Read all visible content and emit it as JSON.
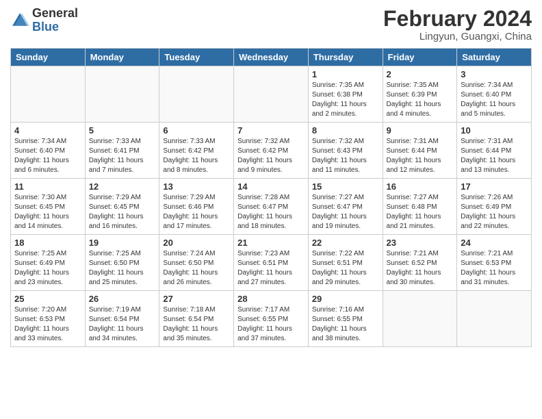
{
  "header": {
    "logo_general": "General",
    "logo_blue": "Blue",
    "month_title": "February 2024",
    "location": "Lingyun, Guangxi, China"
  },
  "days_of_week": [
    "Sunday",
    "Monday",
    "Tuesday",
    "Wednesday",
    "Thursday",
    "Friday",
    "Saturday"
  ],
  "weeks": [
    [
      {
        "num": "",
        "info": ""
      },
      {
        "num": "",
        "info": ""
      },
      {
        "num": "",
        "info": ""
      },
      {
        "num": "",
        "info": ""
      },
      {
        "num": "1",
        "info": "Sunrise: 7:35 AM\nSunset: 6:38 PM\nDaylight: 11 hours and 2 minutes."
      },
      {
        "num": "2",
        "info": "Sunrise: 7:35 AM\nSunset: 6:39 PM\nDaylight: 11 hours and 4 minutes."
      },
      {
        "num": "3",
        "info": "Sunrise: 7:34 AM\nSunset: 6:40 PM\nDaylight: 11 hours and 5 minutes."
      }
    ],
    [
      {
        "num": "4",
        "info": "Sunrise: 7:34 AM\nSunset: 6:40 PM\nDaylight: 11 hours and 6 minutes."
      },
      {
        "num": "5",
        "info": "Sunrise: 7:33 AM\nSunset: 6:41 PM\nDaylight: 11 hours and 7 minutes."
      },
      {
        "num": "6",
        "info": "Sunrise: 7:33 AM\nSunset: 6:42 PM\nDaylight: 11 hours and 8 minutes."
      },
      {
        "num": "7",
        "info": "Sunrise: 7:32 AM\nSunset: 6:42 PM\nDaylight: 11 hours and 9 minutes."
      },
      {
        "num": "8",
        "info": "Sunrise: 7:32 AM\nSunset: 6:43 PM\nDaylight: 11 hours and 11 minutes."
      },
      {
        "num": "9",
        "info": "Sunrise: 7:31 AM\nSunset: 6:44 PM\nDaylight: 11 hours and 12 minutes."
      },
      {
        "num": "10",
        "info": "Sunrise: 7:31 AM\nSunset: 6:44 PM\nDaylight: 11 hours and 13 minutes."
      }
    ],
    [
      {
        "num": "11",
        "info": "Sunrise: 7:30 AM\nSunset: 6:45 PM\nDaylight: 11 hours and 14 minutes."
      },
      {
        "num": "12",
        "info": "Sunrise: 7:29 AM\nSunset: 6:45 PM\nDaylight: 11 hours and 16 minutes."
      },
      {
        "num": "13",
        "info": "Sunrise: 7:29 AM\nSunset: 6:46 PM\nDaylight: 11 hours and 17 minutes."
      },
      {
        "num": "14",
        "info": "Sunrise: 7:28 AM\nSunset: 6:47 PM\nDaylight: 11 hours and 18 minutes."
      },
      {
        "num": "15",
        "info": "Sunrise: 7:27 AM\nSunset: 6:47 PM\nDaylight: 11 hours and 19 minutes."
      },
      {
        "num": "16",
        "info": "Sunrise: 7:27 AM\nSunset: 6:48 PM\nDaylight: 11 hours and 21 minutes."
      },
      {
        "num": "17",
        "info": "Sunrise: 7:26 AM\nSunset: 6:49 PM\nDaylight: 11 hours and 22 minutes."
      }
    ],
    [
      {
        "num": "18",
        "info": "Sunrise: 7:25 AM\nSunset: 6:49 PM\nDaylight: 11 hours and 23 minutes."
      },
      {
        "num": "19",
        "info": "Sunrise: 7:25 AM\nSunset: 6:50 PM\nDaylight: 11 hours and 25 minutes."
      },
      {
        "num": "20",
        "info": "Sunrise: 7:24 AM\nSunset: 6:50 PM\nDaylight: 11 hours and 26 minutes."
      },
      {
        "num": "21",
        "info": "Sunrise: 7:23 AM\nSunset: 6:51 PM\nDaylight: 11 hours and 27 minutes."
      },
      {
        "num": "22",
        "info": "Sunrise: 7:22 AM\nSunset: 6:51 PM\nDaylight: 11 hours and 29 minutes."
      },
      {
        "num": "23",
        "info": "Sunrise: 7:21 AM\nSunset: 6:52 PM\nDaylight: 11 hours and 30 minutes."
      },
      {
        "num": "24",
        "info": "Sunrise: 7:21 AM\nSunset: 6:53 PM\nDaylight: 11 hours and 31 minutes."
      }
    ],
    [
      {
        "num": "25",
        "info": "Sunrise: 7:20 AM\nSunset: 6:53 PM\nDaylight: 11 hours and 33 minutes."
      },
      {
        "num": "26",
        "info": "Sunrise: 7:19 AM\nSunset: 6:54 PM\nDaylight: 11 hours and 34 minutes."
      },
      {
        "num": "27",
        "info": "Sunrise: 7:18 AM\nSunset: 6:54 PM\nDaylight: 11 hours and 35 minutes."
      },
      {
        "num": "28",
        "info": "Sunrise: 7:17 AM\nSunset: 6:55 PM\nDaylight: 11 hours and 37 minutes."
      },
      {
        "num": "29",
        "info": "Sunrise: 7:16 AM\nSunset: 6:55 PM\nDaylight: 11 hours and 38 minutes."
      },
      {
        "num": "",
        "info": ""
      },
      {
        "num": "",
        "info": ""
      }
    ]
  ]
}
